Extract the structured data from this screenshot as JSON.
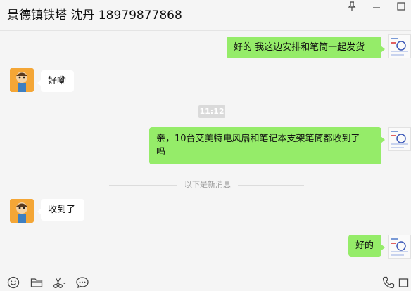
{
  "window": {
    "title": "景德镇铁塔 沈丹 18979877868"
  },
  "icons": {
    "pin": "pin-icon",
    "minimize": "minimize-icon",
    "maximize": "maximize-icon",
    "emoji": "emoji-icon",
    "folder": "folder-icon",
    "screenshot": "scissors-icon",
    "chat_history": "chat-bubble-icon",
    "voice_call": "phone-icon",
    "video_call": "video-icon"
  },
  "messages": [
    {
      "side": "me",
      "text": "好的 我这边安排和笔筒一起发货"
    },
    {
      "side": "them",
      "text": "好嘞"
    },
    {
      "side": "me",
      "text_line1": "亲，10台艾美特电风扇和笔记本支架笔筒都收到了",
      "text_line2": "吗"
    },
    {
      "side": "them",
      "text": "收到了"
    },
    {
      "side": "me",
      "text": "好的"
    }
  ],
  "time_separator": "11:12",
  "new_messages_label": "以下是新消息",
  "colors": {
    "my_bubble": "#95ec69",
    "their_bubble": "#ffffff",
    "background": "#f5f5f5"
  }
}
